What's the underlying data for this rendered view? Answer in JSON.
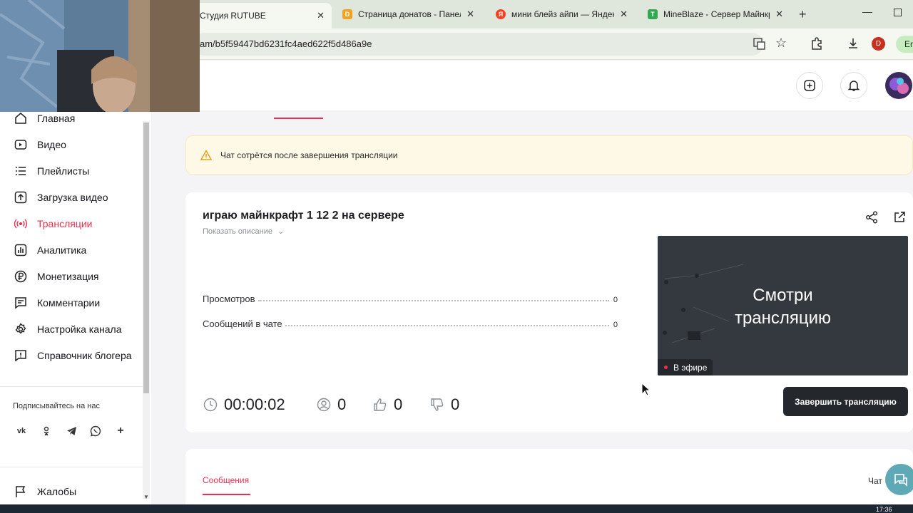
{
  "browser": {
    "tabs": [
      {
        "label": "Студия RUTUBE",
        "active": true
      },
      {
        "label": "Страница донатов - Панель",
        "active": false
      },
      {
        "label": "мини блейз айпи — Яндекс",
        "active": false
      },
      {
        "label": "MineBlaze - Сервер Майнкр",
        "active": false
      }
    ],
    "url": "am/b5f59447bd6231fc4aed622f5d486a9e",
    "profile_initial": "D",
    "extra_label": "Err"
  },
  "sidebar": {
    "items": [
      {
        "label": "Главная",
        "icon": "home-icon"
      },
      {
        "label": "Видео",
        "icon": "video-icon"
      },
      {
        "label": "Плейлисты",
        "icon": "playlist-icon"
      },
      {
        "label": "Загрузка видео",
        "icon": "upload-icon"
      },
      {
        "label": "Трансляции",
        "icon": "broadcast-icon",
        "active": true
      },
      {
        "label": "Аналитика",
        "icon": "analytics-icon"
      },
      {
        "label": "Монетизация",
        "icon": "ruble-icon"
      },
      {
        "label": "Комментарии",
        "icon": "comment-icon"
      },
      {
        "label": "Настройка канала",
        "icon": "gear-icon"
      },
      {
        "label": "Справочник блогера",
        "icon": "help-icon"
      }
    ],
    "subscribe_label": "Подписывайтесь на нас",
    "socials": [
      "vk",
      "ok",
      "telegram",
      "viber",
      "+"
    ],
    "complaints_label": "Жалобы"
  },
  "notice": {
    "text": "Чат сотрётся после завершения трансляции"
  },
  "stream": {
    "title": "играю майнкрафт 1 12 2 на сервере",
    "show_description": "Показать описание",
    "stats": [
      {
        "label": "Просмотров",
        "value": "0"
      },
      {
        "label": "Сообщений в чате",
        "value": "0"
      }
    ],
    "duration": "00:00:02",
    "viewers": "0",
    "likes": "0",
    "dislikes": "0",
    "preview_text_line1": "Смотри",
    "preview_text_line2": "трансляцию",
    "live_badge": "В эфире",
    "end_button": "Завершить трансляцию"
  },
  "chat": {
    "messages_tab": "Сообщения",
    "chat_label": "Чат"
  },
  "taskbar": {
    "time": "17:36"
  },
  "colors": {
    "accent": "#ee2e4f",
    "dark_button": "#24272b",
    "notice_bg": "#fef9e6"
  }
}
